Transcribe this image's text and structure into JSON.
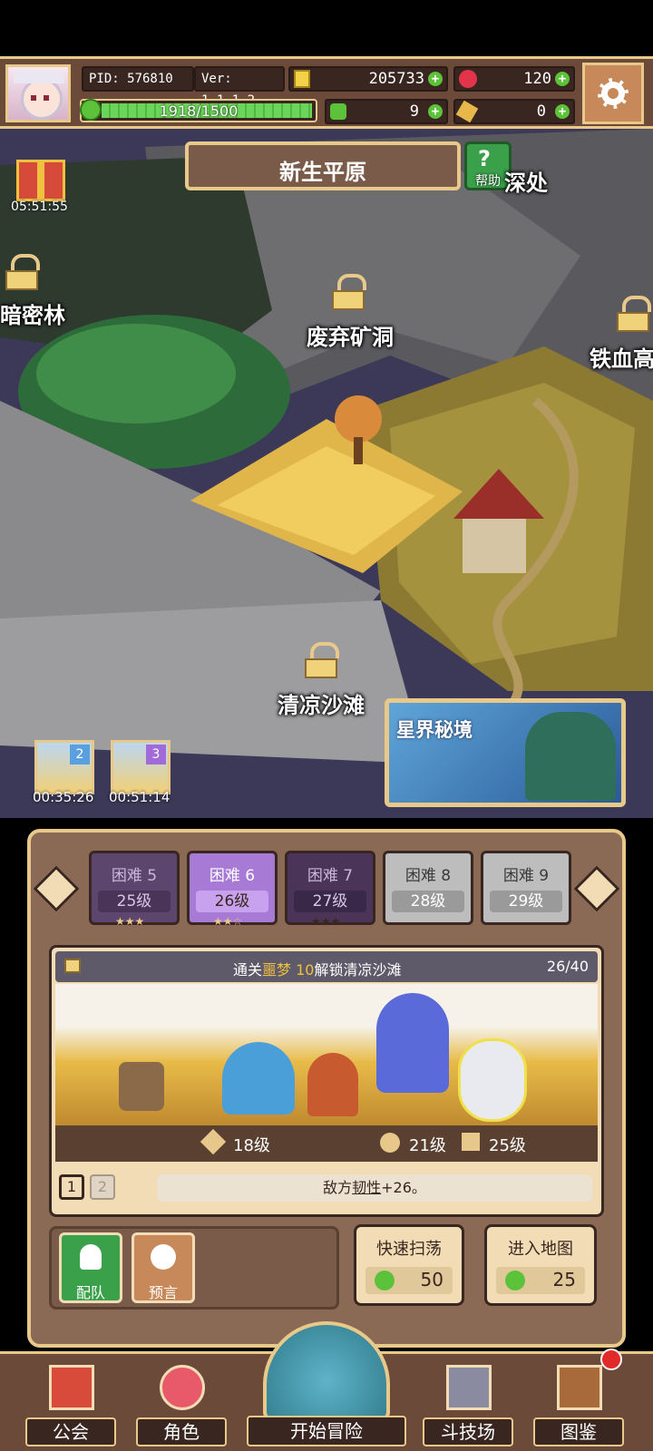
{
  "header": {
    "pid": "PID: 576810",
    "version": "Ver: 1.1.1.2",
    "gold": "205733",
    "gems": "120",
    "exp_text": "1918/1500",
    "clover": "9",
    "ticket": "0"
  },
  "map": {
    "region_title": "新生平原",
    "help_label": "帮助",
    "gift_timer": "05:51:55",
    "locations": {
      "dark_forest": "暗密林",
      "abandoned_mine": "废弃矿洞",
      "iron_blood": "铁血高",
      "deep_place": "深处",
      "cool_beach": "清凉沙滩"
    },
    "chest_timers": [
      "00:35:26",
      "00:51:14"
    ],
    "chest_badges": [
      "2",
      "3"
    ],
    "star_realm": "星界秘境"
  },
  "difficulties": [
    {
      "label": "困难 5",
      "level": "25级"
    },
    {
      "label": "困难 6",
      "level": "26级"
    },
    {
      "label": "困难 7",
      "level": "27级"
    },
    {
      "label": "困难 8",
      "level": "28级"
    },
    {
      "label": "困难 9",
      "level": "29级"
    }
  ],
  "stage": {
    "unlock_prefix": "通关",
    "unlock_highlight": "噩梦 10",
    "unlock_suffix": "解锁清凉沙滩",
    "progress": "26/40",
    "req_level_1": "18级",
    "req_level_2": "21级",
    "req_level_3": "25级",
    "wave_1": "1",
    "wave_2": "2",
    "modifier_prefix": "敌方",
    "modifier_keyword": "韧性",
    "modifier_suffix": "+26。"
  },
  "actions": {
    "team": "配队",
    "prophecy": "预言",
    "quick_sweep": "快速扫荡",
    "quick_sweep_cost": "50",
    "enter_map": "进入地图",
    "enter_map_cost": "25"
  },
  "nav": {
    "guild": "公会",
    "character": "角色",
    "adventure": "开始冒险",
    "arena": "斗技场",
    "codex": "图鉴"
  },
  "colors": {
    "panel_brown": "#8a6a55",
    "border_gold": "#e9c98a",
    "selected_purple": "#a77ad6",
    "plus_green": "#5cc23a"
  }
}
